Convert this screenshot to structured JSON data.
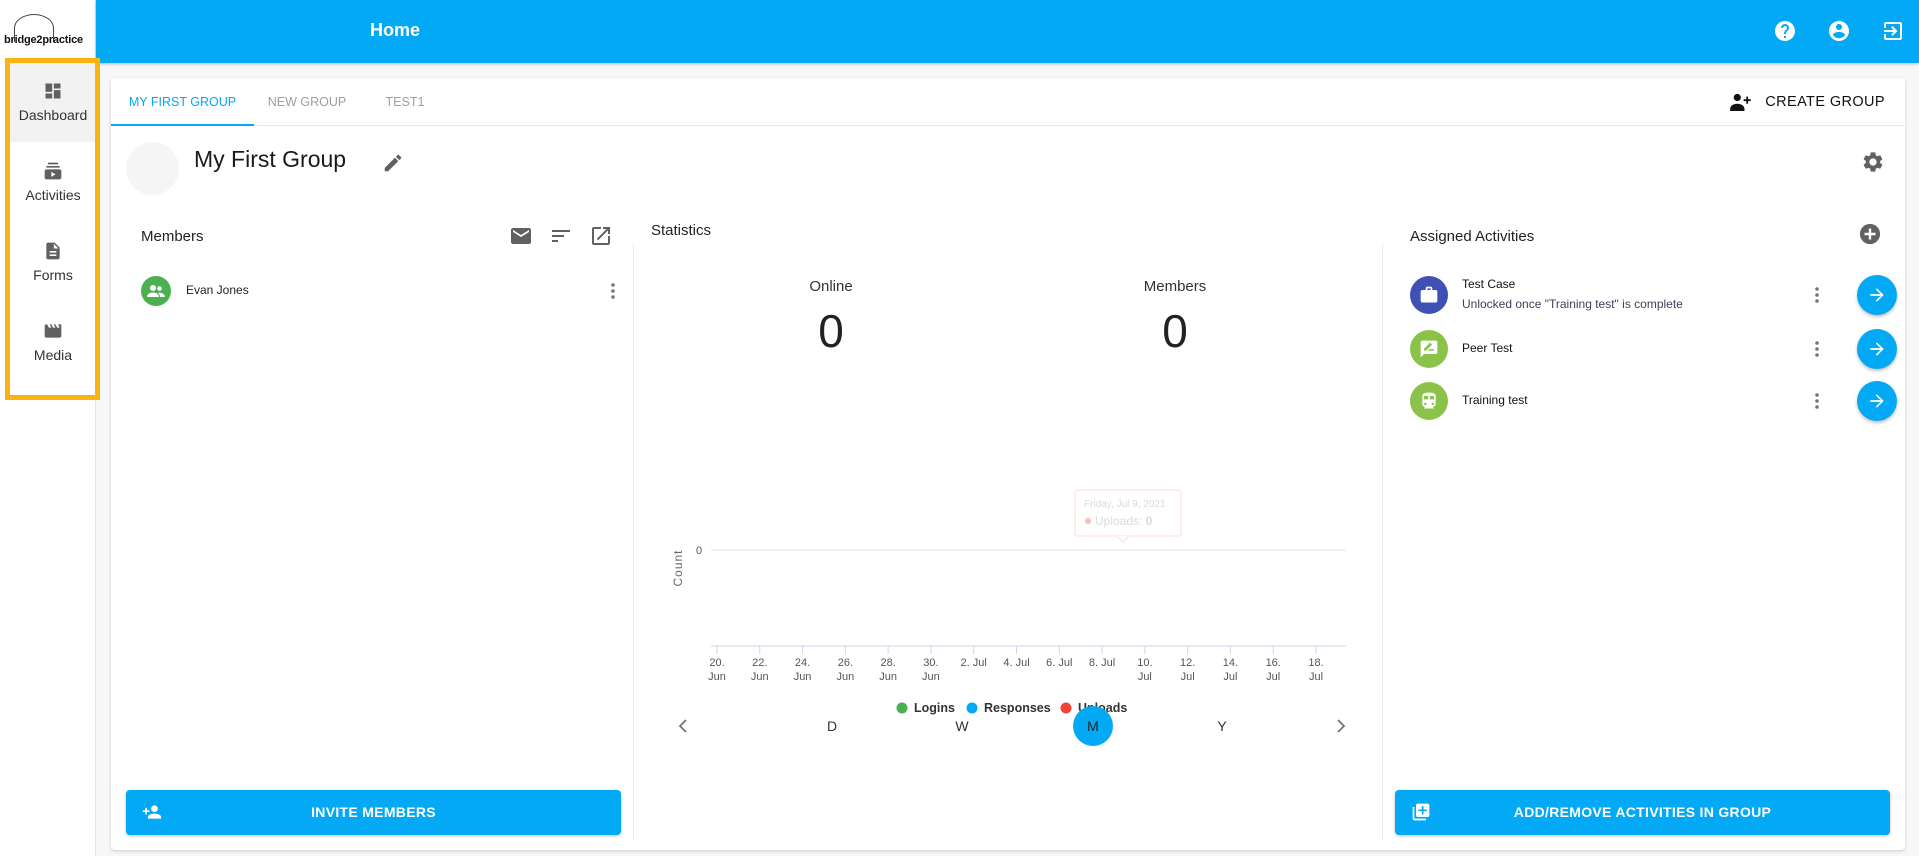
{
  "app": {
    "logo_text": "bridge2practice",
    "page_title": "Home"
  },
  "sidebar": {
    "items": [
      {
        "label": "Dashboard",
        "icon": "dashboard-icon",
        "active": true
      },
      {
        "label": "Activities",
        "icon": "activities-icon",
        "active": false
      },
      {
        "label": "Forms",
        "icon": "forms-icon",
        "active": false
      },
      {
        "label": "Media",
        "icon": "media-icon",
        "active": false
      }
    ],
    "highlight_color": "#fbb40f"
  },
  "topbar": {
    "icons": [
      "help-icon",
      "account-icon",
      "logout-icon"
    ],
    "color": "#03a9f4"
  },
  "tabs": {
    "items": [
      {
        "label": "MY FIRST GROUP",
        "active": true
      },
      {
        "label": "NEW GROUP",
        "active": false
      },
      {
        "label": "TEST1",
        "active": false
      }
    ],
    "create_group_label": "CREATE GROUP"
  },
  "group": {
    "name": "My First Group"
  },
  "members": {
    "title": "Members",
    "list": [
      {
        "name": "Evan Jones",
        "avatar_color": "#4caf50"
      }
    ],
    "invite_label": "INVITE MEMBERS"
  },
  "statistics": {
    "title": "Statistics",
    "online_label": "Online",
    "online_value": "0",
    "members_label": "Members",
    "members_value": "0",
    "range_options": [
      "D",
      "W",
      "M",
      "Y"
    ],
    "range_selected": "M",
    "tooltip": {
      "date": "Friday, Jul 9, 2021",
      "series": "Uploads",
      "value": "0"
    }
  },
  "chart_data": {
    "type": "line",
    "title": "",
    "xlabel": "",
    "ylabel": "Count",
    "x_ticks": [
      [
        "20.",
        "Jun"
      ],
      [
        "22.",
        "Jun"
      ],
      [
        "24.",
        "Jun"
      ],
      [
        "26.",
        "Jun"
      ],
      [
        "28.",
        "Jun"
      ],
      [
        "30.",
        "Jun"
      ],
      [
        "2. Jul",
        ""
      ],
      [
        "4. Jul",
        ""
      ],
      [
        "6. Jul",
        ""
      ],
      [
        "8. Jul",
        ""
      ],
      [
        "10.",
        "Jul"
      ],
      [
        "12.",
        "Jul"
      ],
      [
        "14.",
        "Jul"
      ],
      [
        "16.",
        "Jul"
      ],
      [
        "18.",
        "Jul"
      ]
    ],
    "y_ticks": [
      "0"
    ],
    "ylim": [
      0,
      0
    ],
    "series": [
      {
        "name": "Logins",
        "color": "#4caf50",
        "values": []
      },
      {
        "name": "Responses",
        "color": "#03a9f4",
        "values": []
      },
      {
        "name": "Uploads",
        "color": "#f44336",
        "values": []
      }
    ],
    "legend_position": "bottom"
  },
  "activities": {
    "title": "Assigned Activities",
    "list": [
      {
        "name": "Test Case",
        "subtitle": "Unlocked once \"Training test\" is complete",
        "icon": "briefcase-icon",
        "color": "#3f51b5"
      },
      {
        "name": "Peer Test",
        "subtitle": "",
        "icon": "feedback-icon",
        "color": "#8bc34a"
      },
      {
        "name": "Training test",
        "subtitle": "",
        "icon": "train-icon",
        "color": "#8bc34a"
      }
    ],
    "add_remove_label": "ADD/REMOVE ACTIVITIES IN GROUP"
  }
}
